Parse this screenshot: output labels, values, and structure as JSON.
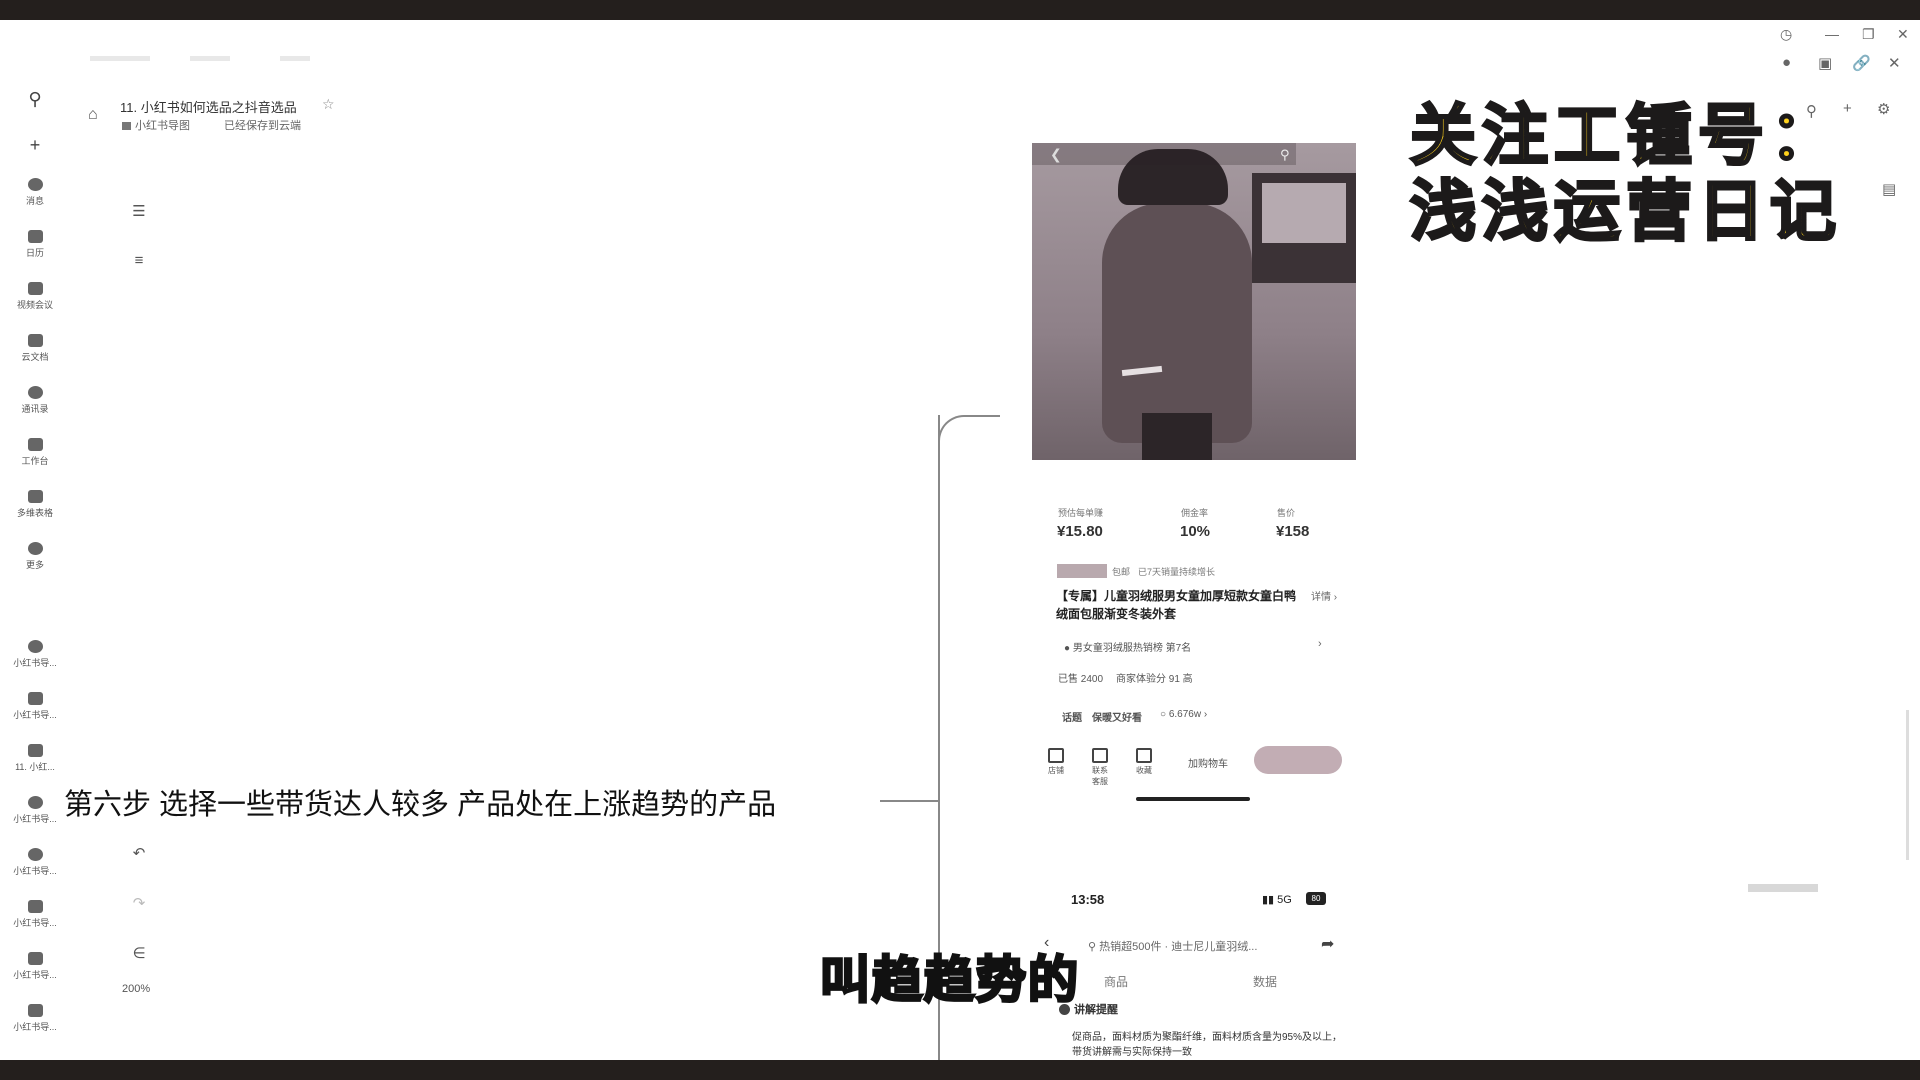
{
  "window": {
    "controls": [
      "history-icon",
      "minimize-icon",
      "restore-icon",
      "close-icon"
    ]
  },
  "doc": {
    "title": "11. 小红书如何选品之抖音选品",
    "folder": "小红书导图",
    "saved": "已经保存到云端",
    "zoom": "200%"
  },
  "rail": {
    "items": [
      "消息",
      "日历",
      "视频会议",
      "云文档",
      "通讯录",
      "工作台",
      "多维表格",
      "更多"
    ],
    "recent": [
      "小红书导...",
      "小红书导...",
      "11. 小红...",
      "小红书导...",
      "小红书导...",
      "小红书导...",
      "小红书导...",
      "小红书导..."
    ]
  },
  "watermark": {
    "line1": "关注工锺号：",
    "line2": "浅浅运营日记"
  },
  "mindmap": {
    "node_text": "第六步 选择一些带货达人较多 产品处在上涨趋势的产品"
  },
  "product": {
    "stats": [
      {
        "label": "预估每单赚",
        "value": "¥15.80"
      },
      {
        "label": "佣金率",
        "value": "10%"
      },
      {
        "label": "售价",
        "value": "¥158"
      }
    ],
    "tag_text": "包邮",
    "tag_note": "已7天销量持续增长",
    "title": "【专属】儿童羽绒服男女童加厚短款女童白鸭绒面包服渐变冬装外套",
    "detail": "详情",
    "rank": "男女童羽绒服热销榜 第7名",
    "sales": "已售 2400",
    "rating": "商家体验分 91 高",
    "topic_tag": "话题",
    "topic": "保暖又好看",
    "topic_count": "6.676w",
    "bottom_buttons": [
      "店铺",
      "联系客服",
      "收藏"
    ],
    "cart": "加购物车",
    "status_time": "13:58",
    "status_signal": "5G",
    "status_battery": "80",
    "search_text": "热销超500件 · 迪士尼儿童羽绒...",
    "tabs": [
      "商品",
      "数据"
    ],
    "section": "讲解提醒",
    "desc": "促商品，面料材质为聚酯纤维，面料材质含量为95%及以上，带货讲解需与实际保持一致"
  },
  "subtitle": "叫趋趋势的"
}
